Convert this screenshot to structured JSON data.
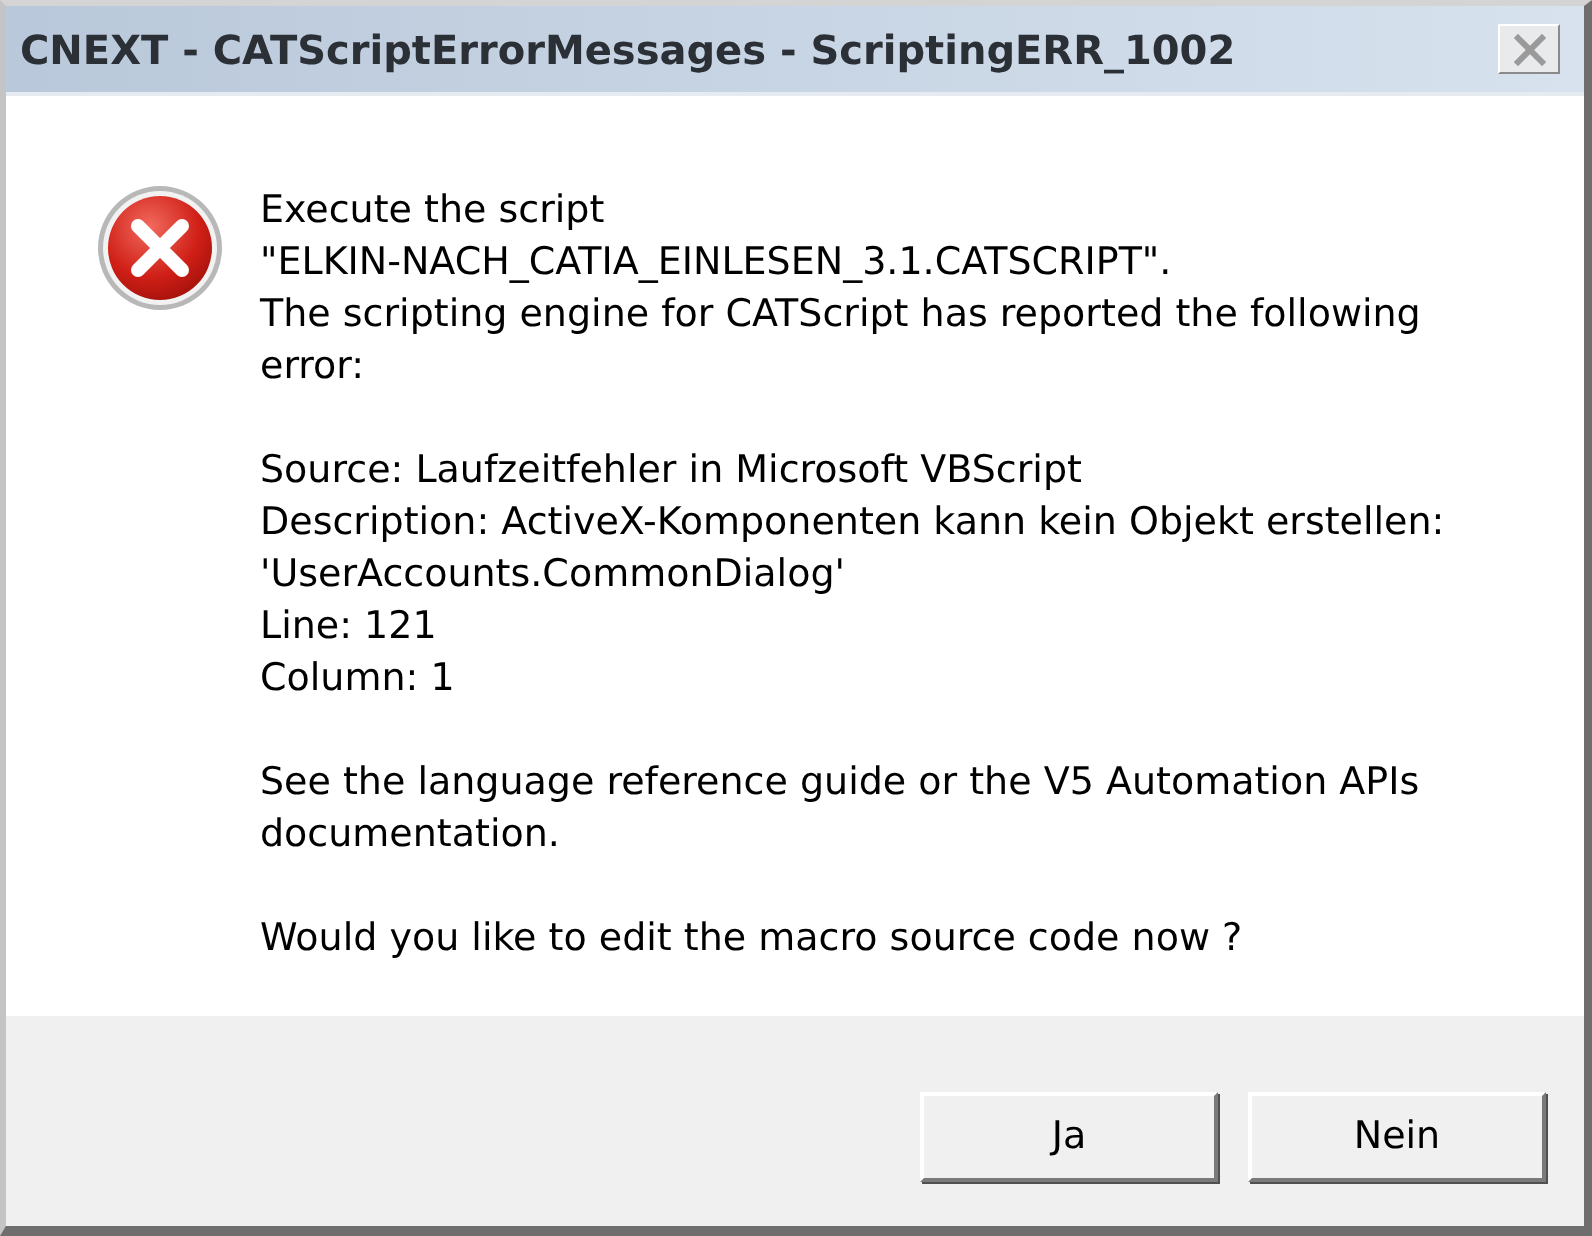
{
  "window": {
    "title": "CNEXT - CATScriptErrorMessages - ScriptingERR_1002"
  },
  "message": {
    "paragraphs": [
      [
        "Execute the script",
        "\"ELKIN-NACH_CATIA_EINLESEN_3.1.CATSCRIPT\".",
        "The scripting engine for CATScript has reported the following error:"
      ],
      [
        "Source: Laufzeitfehler in Microsoft VBScript",
        "Description: ActiveX-Komponenten kann kein Objekt erstellen: 'UserAccounts.CommonDialog'",
        "Line: 121",
        "Column: 1"
      ],
      [
        "See the language reference guide or the V5 Automation APIs documentation."
      ],
      [
        "Would you like to edit the macro source code now ?"
      ]
    ]
  },
  "buttons": [
    {
      "label": "Ja"
    },
    {
      "label": "Nein"
    }
  ]
}
